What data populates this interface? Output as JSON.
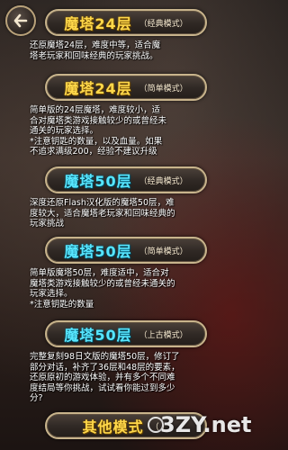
{
  "modes": [
    {
      "title": "魔塔24层",
      "subtitle": "（经典模式）",
      "lines": [
        "还原魔塔24层，难度中等，适合魔",
        "塔老玩家和回味经典的玩家挑战。"
      ]
    },
    {
      "title": "魔塔24层",
      "subtitle": "（简单模式）",
      "lines": [
        "简单版的24层魔塔，难度较小，适",
        "合对魔塔类游戏接触较少的或曾经未",
        "通关的玩家选择。",
        "*注意钥匙的数量，以及血量。如果",
        "不追求满级200，经验不建议升级"
      ]
    },
    {
      "title": "魔塔50层",
      "subtitle": "（经典模式）",
      "lines": [
        "深度还原Flash汉化版的魔塔50层，难",
        "度较大，适合魔塔老玩家和回味经典的",
        "玩家挑战"
      ]
    },
    {
      "title": "魔塔50层",
      "subtitle": "（简单模式）",
      "lines": [
        "简单版魔塔50层，难度适中，适合对",
        "魔塔类游戏接触较少的或曾经未通关的",
        "玩家选择。",
        "*注意钥匙的数量"
      ]
    },
    {
      "title": "魔塔50层",
      "subtitle": "（上古模式）",
      "lines": [
        "完整复刻98日文版的魔塔50层，修订了",
        "部分对话，补齐了36层和48层的要素，",
        "还原原初的游戏体验，并有多个不同难",
        "度结局等你挑战，试试看你能过到多少",
        "分?"
      ]
    },
    {
      "title": "其他模式",
      "subtitle": "（ ）",
      "lines": []
    }
  ],
  "watermark": "3ZY.net",
  "icons": {
    "back": "back-arrow-icon"
  },
  "colors": {
    "gold": "#ffd84a",
    "cyan": "#57e6ff",
    "border": "#c8b48c"
  }
}
